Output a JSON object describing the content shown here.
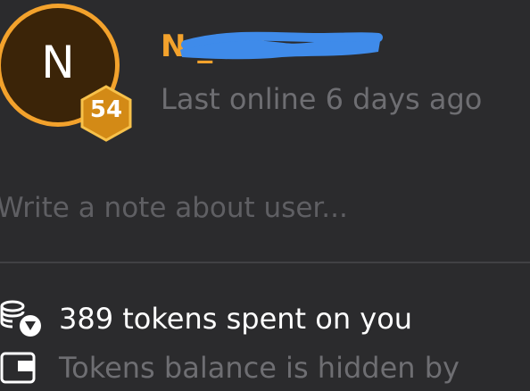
{
  "profile": {
    "avatar_letter": "N",
    "level": "54",
    "username": "N   _505",
    "last_online": "Last online 6 days ago"
  },
  "note": {
    "placeholder": "Write a note about user..."
  },
  "stats": {
    "tokens_spent": "389 tokens spent on you",
    "balance_hidden": "Tokens balance is hidden by"
  },
  "colors": {
    "accent": "#f3a22c",
    "background": "#2b2b2d",
    "redaction": "#3f8bea",
    "muted_text": "#6e6e72"
  },
  "icons": {
    "tokens": "coin-stack-icon",
    "balance": "wallet-icon"
  }
}
